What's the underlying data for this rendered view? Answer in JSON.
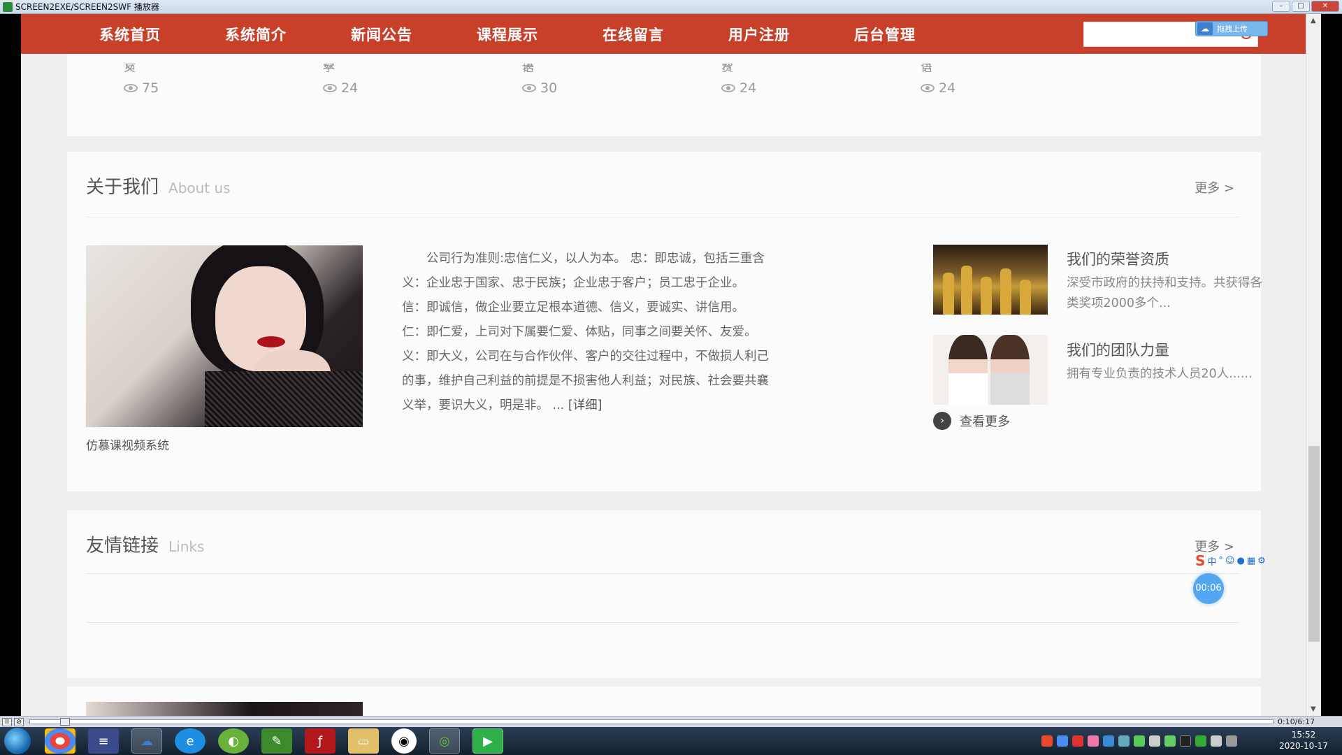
{
  "window": {
    "title": "SCREEN2EXE/SCREEN2SWF 播放器"
  },
  "nav": {
    "items": [
      "系统首页",
      "系统简介",
      "新闻公告",
      "课程展示",
      "在线留言",
      "用户注册",
      "后台管理"
    ],
    "upload_label": "拖拽上传"
  },
  "stats": [
    {
      "label": "语文",
      "views": "75"
    },
    {
      "label": "数学",
      "views": "24"
    },
    {
      "label": "英语",
      "views": "30"
    },
    {
      "label": "外贸",
      "views": "24"
    },
    {
      "label": "日语",
      "views": "24"
    }
  ],
  "about": {
    "title": "关于我们",
    "title_en": "About us",
    "more": "更多 >",
    "photo_caption": "仿慕课视频系统",
    "text": "公司行为准则:忠信仁义，以人为本。 忠：即忠诚，包括三重含义：企业忠于国家、忠于民族；企业忠于客户；员工忠于企业。 信：即诚信，做企业要立足根本道德、信义，要诚实、讲信用。 仁：即仁爱，上司对下属要仁爱、体贴，同事之间要关怀、友爱。 义：即大义，公司在与合作伙伴、客户的交往过程中，不做损人利己的事，维护自己利益的前提是不损害他人利益；对民族、社会要共襄义举，要识大义，明是非。 ...",
    "detail": "[详细]",
    "side": [
      {
        "title": "我们的荣誉资质",
        "desc": "深受市政府的扶持和支持。共获得各类奖项2000多个..."
      },
      {
        "title": "我们的团队力量",
        "desc": "拥有专业负责的技术人员20人......"
      }
    ],
    "view_more": "查看更多"
  },
  "links": {
    "title": "友情链接",
    "title_en": "Links",
    "more": "更多 >"
  },
  "timer": "00:06",
  "player": {
    "time": "0:10/6:17"
  },
  "clock": {
    "time": "15:52",
    "date": "2020-10-17"
  },
  "colors": {
    "nav_bg": "#c9402a",
    "page_bg": "#efefef",
    "panel_bg": "#fbfbfb",
    "timer_bg": "#55a6f0"
  },
  "icons": [
    "eye-icon",
    "search-icon",
    "chevron-right-icon",
    "windows-start-icon"
  ]
}
